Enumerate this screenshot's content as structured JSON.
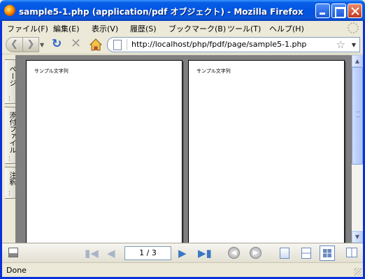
{
  "window": {
    "title": "sample5-1.php (application/pdf オブジェクト) - Mozilla Firefox"
  },
  "menu": [
    {
      "label": "ファイル(F)"
    },
    {
      "label": "編集(E)"
    },
    {
      "label": "表示(V)"
    },
    {
      "label": "履歴(S)"
    },
    {
      "label": "ブックマーク(B)"
    },
    {
      "label": "ツール(T)"
    },
    {
      "label": "ヘルプ(H)"
    }
  ],
  "address_bar": {
    "url": "http://localhost/php/fpdf/page/sample5-1.php"
  },
  "side_tabs": [
    {
      "label": "ページ"
    },
    {
      "label": "添付ファイル"
    },
    {
      "label": "注釈"
    }
  ],
  "pages": [
    {
      "text": "サンプル文字列"
    },
    {
      "text": "サンプル文字列"
    }
  ],
  "pdf_toolbar": {
    "page_indicator": "1 / 3"
  },
  "status": {
    "text": "Done"
  },
  "icons": {
    "back": "back-arrow-icon",
    "forward": "forward-arrow-icon",
    "reload": "reload-icon",
    "stop": "stop-icon",
    "home": "home-icon",
    "bookmark": "star-icon"
  }
}
